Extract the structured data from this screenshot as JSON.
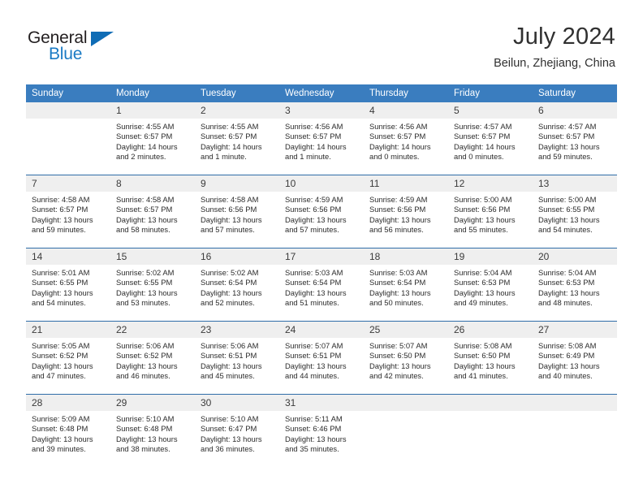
{
  "brand": {
    "name_part1": "General",
    "name_part2": "Blue",
    "triangle_icon": "triangle-icon",
    "accent_color": "#0f6cb5"
  },
  "header": {
    "title": "July 2024",
    "subtitle": "Beilun, Zhejiang, China"
  },
  "colors": {
    "header_blue": "#3a7dbf",
    "row_divider_blue": "#2f6da8",
    "day_number_bg": "#efefef",
    "text": "#2b2b2b"
  },
  "weekdays": [
    "Sunday",
    "Monday",
    "Tuesday",
    "Wednesday",
    "Thursday",
    "Friday",
    "Saturday"
  ],
  "weeks": [
    [
      {
        "day": "",
        "sunrise": "",
        "sunset": "",
        "daylight_line1": "",
        "daylight_line2": "",
        "empty": true
      },
      {
        "day": "1",
        "sunrise": "Sunrise: 4:55 AM",
        "sunset": "Sunset: 6:57 PM",
        "daylight_line1": "Daylight: 14 hours",
        "daylight_line2": "and 2 minutes."
      },
      {
        "day": "2",
        "sunrise": "Sunrise: 4:55 AM",
        "sunset": "Sunset: 6:57 PM",
        "daylight_line1": "Daylight: 14 hours",
        "daylight_line2": "and 1 minute."
      },
      {
        "day": "3",
        "sunrise": "Sunrise: 4:56 AM",
        "sunset": "Sunset: 6:57 PM",
        "daylight_line1": "Daylight: 14 hours",
        "daylight_line2": "and 1 minute."
      },
      {
        "day": "4",
        "sunrise": "Sunrise: 4:56 AM",
        "sunset": "Sunset: 6:57 PM",
        "daylight_line1": "Daylight: 14 hours",
        "daylight_line2": "and 0 minutes."
      },
      {
        "day": "5",
        "sunrise": "Sunrise: 4:57 AM",
        "sunset": "Sunset: 6:57 PM",
        "daylight_line1": "Daylight: 14 hours",
        "daylight_line2": "and 0 minutes."
      },
      {
        "day": "6",
        "sunrise": "Sunrise: 4:57 AM",
        "sunset": "Sunset: 6:57 PM",
        "daylight_line1": "Daylight: 13 hours",
        "daylight_line2": "and 59 minutes."
      }
    ],
    [
      {
        "day": "7",
        "sunrise": "Sunrise: 4:58 AM",
        "sunset": "Sunset: 6:57 PM",
        "daylight_line1": "Daylight: 13 hours",
        "daylight_line2": "and 59 minutes."
      },
      {
        "day": "8",
        "sunrise": "Sunrise: 4:58 AM",
        "sunset": "Sunset: 6:57 PM",
        "daylight_line1": "Daylight: 13 hours",
        "daylight_line2": "and 58 minutes."
      },
      {
        "day": "9",
        "sunrise": "Sunrise: 4:58 AM",
        "sunset": "Sunset: 6:56 PM",
        "daylight_line1": "Daylight: 13 hours",
        "daylight_line2": "and 57 minutes."
      },
      {
        "day": "10",
        "sunrise": "Sunrise: 4:59 AM",
        "sunset": "Sunset: 6:56 PM",
        "daylight_line1": "Daylight: 13 hours",
        "daylight_line2": "and 57 minutes."
      },
      {
        "day": "11",
        "sunrise": "Sunrise: 4:59 AM",
        "sunset": "Sunset: 6:56 PM",
        "daylight_line1": "Daylight: 13 hours",
        "daylight_line2": "and 56 minutes."
      },
      {
        "day": "12",
        "sunrise": "Sunrise: 5:00 AM",
        "sunset": "Sunset: 6:56 PM",
        "daylight_line1": "Daylight: 13 hours",
        "daylight_line2": "and 55 minutes."
      },
      {
        "day": "13",
        "sunrise": "Sunrise: 5:00 AM",
        "sunset": "Sunset: 6:55 PM",
        "daylight_line1": "Daylight: 13 hours",
        "daylight_line2": "and 54 minutes."
      }
    ],
    [
      {
        "day": "14",
        "sunrise": "Sunrise: 5:01 AM",
        "sunset": "Sunset: 6:55 PM",
        "daylight_line1": "Daylight: 13 hours",
        "daylight_line2": "and 54 minutes."
      },
      {
        "day": "15",
        "sunrise": "Sunrise: 5:02 AM",
        "sunset": "Sunset: 6:55 PM",
        "daylight_line1": "Daylight: 13 hours",
        "daylight_line2": "and 53 minutes."
      },
      {
        "day": "16",
        "sunrise": "Sunrise: 5:02 AM",
        "sunset": "Sunset: 6:54 PM",
        "daylight_line1": "Daylight: 13 hours",
        "daylight_line2": "and 52 minutes."
      },
      {
        "day": "17",
        "sunrise": "Sunrise: 5:03 AM",
        "sunset": "Sunset: 6:54 PM",
        "daylight_line1": "Daylight: 13 hours",
        "daylight_line2": "and 51 minutes."
      },
      {
        "day": "18",
        "sunrise": "Sunrise: 5:03 AM",
        "sunset": "Sunset: 6:54 PM",
        "daylight_line1": "Daylight: 13 hours",
        "daylight_line2": "and 50 minutes."
      },
      {
        "day": "19",
        "sunrise": "Sunrise: 5:04 AM",
        "sunset": "Sunset: 6:53 PM",
        "daylight_line1": "Daylight: 13 hours",
        "daylight_line2": "and 49 minutes."
      },
      {
        "day": "20",
        "sunrise": "Sunrise: 5:04 AM",
        "sunset": "Sunset: 6:53 PM",
        "daylight_line1": "Daylight: 13 hours",
        "daylight_line2": "and 48 minutes."
      }
    ],
    [
      {
        "day": "21",
        "sunrise": "Sunrise: 5:05 AM",
        "sunset": "Sunset: 6:52 PM",
        "daylight_line1": "Daylight: 13 hours",
        "daylight_line2": "and 47 minutes."
      },
      {
        "day": "22",
        "sunrise": "Sunrise: 5:06 AM",
        "sunset": "Sunset: 6:52 PM",
        "daylight_line1": "Daylight: 13 hours",
        "daylight_line2": "and 46 minutes."
      },
      {
        "day": "23",
        "sunrise": "Sunrise: 5:06 AM",
        "sunset": "Sunset: 6:51 PM",
        "daylight_line1": "Daylight: 13 hours",
        "daylight_line2": "and 45 minutes."
      },
      {
        "day": "24",
        "sunrise": "Sunrise: 5:07 AM",
        "sunset": "Sunset: 6:51 PM",
        "daylight_line1": "Daylight: 13 hours",
        "daylight_line2": "and 44 minutes."
      },
      {
        "day": "25",
        "sunrise": "Sunrise: 5:07 AM",
        "sunset": "Sunset: 6:50 PM",
        "daylight_line1": "Daylight: 13 hours",
        "daylight_line2": "and 42 minutes."
      },
      {
        "day": "26",
        "sunrise": "Sunrise: 5:08 AM",
        "sunset": "Sunset: 6:50 PM",
        "daylight_line1": "Daylight: 13 hours",
        "daylight_line2": "and 41 minutes."
      },
      {
        "day": "27",
        "sunrise": "Sunrise: 5:08 AM",
        "sunset": "Sunset: 6:49 PM",
        "daylight_line1": "Daylight: 13 hours",
        "daylight_line2": "and 40 minutes."
      }
    ],
    [
      {
        "day": "28",
        "sunrise": "Sunrise: 5:09 AM",
        "sunset": "Sunset: 6:48 PM",
        "daylight_line1": "Daylight: 13 hours",
        "daylight_line2": "and 39 minutes."
      },
      {
        "day": "29",
        "sunrise": "Sunrise: 5:10 AM",
        "sunset": "Sunset: 6:48 PM",
        "daylight_line1": "Daylight: 13 hours",
        "daylight_line2": "and 38 minutes."
      },
      {
        "day": "30",
        "sunrise": "Sunrise: 5:10 AM",
        "sunset": "Sunset: 6:47 PM",
        "daylight_line1": "Daylight: 13 hours",
        "daylight_line2": "and 36 minutes."
      },
      {
        "day": "31",
        "sunrise": "Sunrise: 5:11 AM",
        "sunset": "Sunset: 6:46 PM",
        "daylight_line1": "Daylight: 13 hours",
        "daylight_line2": "and 35 minutes."
      },
      {
        "day": "",
        "sunrise": "",
        "sunset": "",
        "daylight_line1": "",
        "daylight_line2": "",
        "empty": true
      },
      {
        "day": "",
        "sunrise": "",
        "sunset": "",
        "daylight_line1": "",
        "daylight_line2": "",
        "empty": true
      },
      {
        "day": "",
        "sunrise": "",
        "sunset": "",
        "daylight_line1": "",
        "daylight_line2": "",
        "empty": true
      }
    ]
  ]
}
